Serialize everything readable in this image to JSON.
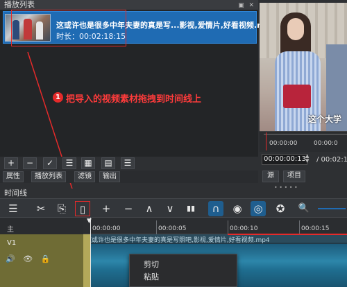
{
  "playlist": {
    "title": "播放列表",
    "window_buttons": "▣ ✕",
    "item": {
      "name": "这或许也是很多中年夫妻的真是写...影视,爱情片,好看视频.mp4",
      "duration": "时长：00:02:18:15"
    },
    "toolbar": [
      "+",
      "−",
      "✓",
      "☰",
      "▦",
      "▤",
      "☰"
    ],
    "tabs": [
      "属性",
      "播放列表",
      "滤镜",
      "输出"
    ]
  },
  "annotation": {
    "number": "1",
    "text": "把导入的视频素材拖拽到时间线上"
  },
  "preview": {
    "caption": "这个大学",
    "scrub_t1": "00:00:00",
    "scrub_t2": "00:00:0",
    "timecode": "00:00:00:13",
    "total": "/  00:02:1",
    "tabs": [
      "源",
      "项目"
    ],
    "splitter": "• • • • •"
  },
  "timeline": {
    "title": "时间线",
    "toolbar_icons": [
      "menu-icon",
      "cut-icon",
      "copy-icon",
      "paste-icon",
      "add-icon",
      "remove-icon",
      "lift-icon",
      "overwrite-icon",
      "split-icon",
      "snap-icon",
      "scrub-icon",
      "ripple-icon",
      "ripple-all-icon",
      "zoom-out-icon"
    ],
    "toolbar_glyphs": [
      "☰",
      "✂",
      "⎘",
      "▯",
      "+",
      "−",
      "∧",
      "∨",
      "▮▮",
      "∩",
      "◉",
      "◎",
      "✪",
      "🔍"
    ],
    "header_main": "主",
    "header_v1": "V1",
    "header_icons": "🔊 👁 🔒",
    "ruler": [
      "00:00:00",
      "00:00:05",
      "00:00:10",
      "00:00:15"
    ],
    "clip_name": "这或许也是很多中年夫妻的真是写照吧,影视,爱情片,好看视频.mp4",
    "playhead_mark": "▼"
  },
  "context_menu": {
    "items": [
      "剪切",
      "粘贴"
    ]
  },
  "colors": {
    "accent": "#1f6bb3",
    "annotation_red": "#e52a2a",
    "track_olive": "#6f6c35",
    "wave_blue": "#2d86aa"
  }
}
